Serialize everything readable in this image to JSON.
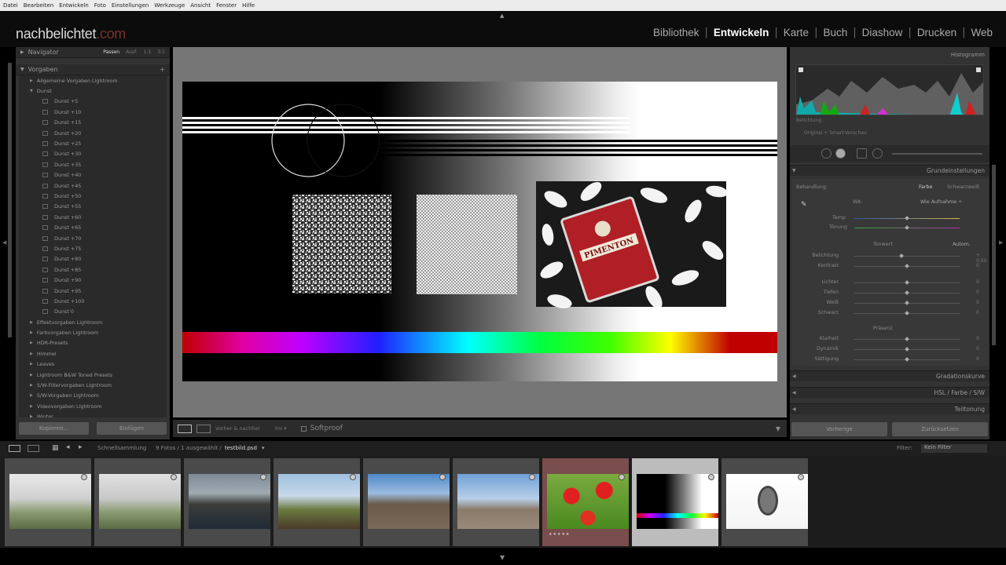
{
  "menu": [
    "Datei",
    "Bearbeiten",
    "Entwickeln",
    "Foto",
    "Einstellungen",
    "Werkzeuge",
    "Ansicht",
    "Fenster",
    "Hilfe"
  ],
  "identity_plate": {
    "name": "nachbelichtet",
    "domain": ".com"
  },
  "modules": [
    {
      "label": "Bibliothek",
      "active": false
    },
    {
      "label": "Entwickeln",
      "active": true
    },
    {
      "label": "Karte",
      "active": false
    },
    {
      "label": "Buch",
      "active": false
    },
    {
      "label": "Diashow",
      "active": false
    },
    {
      "label": "Drucken",
      "active": false
    },
    {
      "label": "Web",
      "active": false
    }
  ],
  "left_panel": {
    "navigator": {
      "title": "Navigator",
      "options": [
        "Passen",
        "Ausf.",
        "1:1",
        "3:1"
      ]
    },
    "presets_title": "Vorgaben",
    "presets": [
      {
        "label": "Allgemeine Vorgaben Lightroom",
        "type": "folder",
        "open": false
      },
      {
        "label": "Dunst",
        "type": "folder",
        "open": true
      },
      {
        "label": "Dunst +5",
        "type": "child"
      },
      {
        "label": "Dunst +10",
        "type": "child"
      },
      {
        "label": "Dunst +15",
        "type": "child"
      },
      {
        "label": "Dunst +20",
        "type": "child"
      },
      {
        "label": "Dunst +25",
        "type": "child"
      },
      {
        "label": "Dunst +30",
        "type": "child"
      },
      {
        "label": "Dunst +35",
        "type": "child"
      },
      {
        "label": "Dunst +40",
        "type": "child"
      },
      {
        "label": "Dunst +45",
        "type": "child"
      },
      {
        "label": "Dunst +50",
        "type": "child"
      },
      {
        "label": "Dunst +55",
        "type": "child"
      },
      {
        "label": "Dunst +60",
        "type": "child"
      },
      {
        "label": "Dunst +65",
        "type": "child"
      },
      {
        "label": "Dunst +70",
        "type": "child"
      },
      {
        "label": "Dunst +75",
        "type": "child"
      },
      {
        "label": "Dunst +80",
        "type": "child"
      },
      {
        "label": "Dunst +85",
        "type": "child"
      },
      {
        "label": "Dunst +90",
        "type": "child"
      },
      {
        "label": "Dunst +95",
        "type": "child"
      },
      {
        "label": "Dunst +100",
        "type": "child"
      },
      {
        "label": "Dunst 0",
        "type": "child"
      },
      {
        "label": "Effektvorgaben Lightroom",
        "type": "folder",
        "open": false
      },
      {
        "label": "Farbvorgaben Lightroom",
        "type": "folder",
        "open": false
      },
      {
        "label": "HDR-Presets",
        "type": "folder",
        "open": false
      },
      {
        "label": "Himmel",
        "type": "folder",
        "open": false
      },
      {
        "label": "Leaves",
        "type": "folder",
        "open": false
      },
      {
        "label": "Lightroom B&W Toned Presets",
        "type": "folder",
        "open": false
      },
      {
        "label": "S/W-Filtervorgaben Lightroom",
        "type": "folder",
        "open": false
      },
      {
        "label": "S/W-Vorgaben Lightroom",
        "type": "folder",
        "open": false
      },
      {
        "label": "Videovorgaben Lightroom",
        "type": "folder",
        "open": false
      },
      {
        "label": "Winter",
        "type": "folder",
        "open": false
      }
    ],
    "copy_button": "Kopieren...",
    "paste_button": "Einfügen"
  },
  "toolbar": {
    "text1": "Vorher & nachher",
    "text2": "Ym ▾",
    "softproof": "Softproof"
  },
  "right_panel": {
    "histogram_title": "Histogramm",
    "histogram_label": "Belichtung",
    "original_label": "Original + Smart-Vorschau",
    "basic_title": "Grundeinstellungen",
    "behandlung": "Behandlung:",
    "farbe": "Farbe",
    "schwarzweiss": "Schwarzweiß",
    "wb_label": "WA:",
    "wb_value": "Wie Aufnahme ÷",
    "temp_label": "Temp.",
    "tint_label": "Tönung",
    "tone_label": "Tonwert",
    "auto_label": "Autom.",
    "tone_sliders": [
      {
        "label": "Belichtung",
        "value": "+ 0,50",
        "pos": 0.45
      },
      {
        "label": "Kontrast",
        "value": "0",
        "pos": 0.5
      }
    ],
    "detail_sliders": [
      {
        "label": "Lichter",
        "value": "0",
        "pos": 0.5
      },
      {
        "label": "Tiefen",
        "value": "0",
        "pos": 0.5
      },
      {
        "label": "Weiß",
        "value": "0",
        "pos": 0.5
      },
      {
        "label": "Schwarz",
        "value": "0",
        "pos": 0.5
      }
    ],
    "presence_label": "Präsenz",
    "presence_sliders": [
      {
        "label": "Klarheit",
        "value": "0",
        "pos": 0.5
      },
      {
        "label": "Dynamik",
        "value": "0",
        "pos": 0.5
      },
      {
        "label": "Sättigung",
        "value": "0",
        "pos": 0.5
      }
    ],
    "sections": [
      "Gradationskurve",
      "HSL / Farbe / S/W",
      "Teiltonung"
    ],
    "prev_button": "Vorherige",
    "reset_button": "Zurücksetzen"
  },
  "filmstrip_bar": {
    "source": "Schnellsammlung",
    "count": "9 Fotos / 1 ausgewählt /",
    "filename": "testbild.psd",
    "filter_label": "Filter:",
    "filter_value": "Kein Filter"
  },
  "thumbnails": [
    {
      "name": "misty-landscape",
      "selected": false,
      "flagged": false
    },
    {
      "name": "misty-landscape-2",
      "selected": false,
      "flagged": false
    },
    {
      "name": "coastal-cliff",
      "selected": false,
      "flagged": false
    },
    {
      "name": "tree-landscape",
      "selected": false,
      "flagged": false
    },
    {
      "name": "volcano",
      "selected": false,
      "flagged": false
    },
    {
      "name": "hill-with-cross",
      "selected": false,
      "flagged": false
    },
    {
      "name": "red-poppies",
      "selected": false,
      "flagged": true,
      "stars": "★★★★★"
    },
    {
      "name": "testbild",
      "selected": true,
      "flagged": false
    },
    {
      "name": "watch",
      "selected": false,
      "flagged": false
    }
  ],
  "colors": {
    "panel": "#333333",
    "accent": "#ffffff",
    "tin_red": "#b01f25"
  },
  "canvas_tin_text": "PIMENTON"
}
